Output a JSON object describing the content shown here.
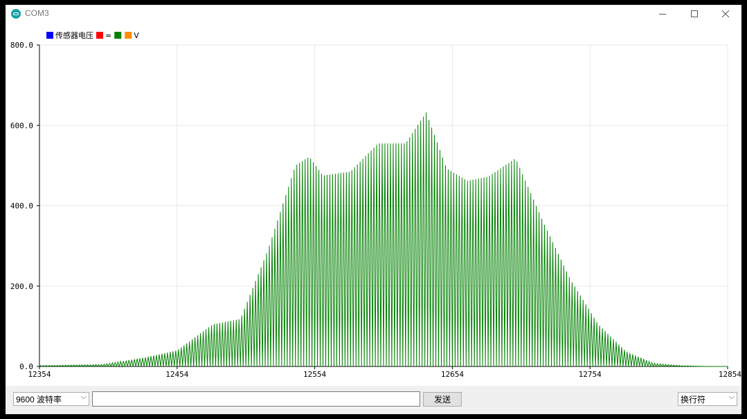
{
  "window": {
    "title": "COM3"
  },
  "legend": [
    {
      "label": "传感器电压",
      "color": "#0000ff"
    },
    {
      "label": "=",
      "color": "#ff0000"
    },
    {
      "label": "",
      "color": "#008000"
    },
    {
      "label": "V",
      "color": "#ff8c00"
    }
  ],
  "chart_data": {
    "type": "line",
    "x_ticks": [
      "12354",
      "12454",
      "12554",
      "12654",
      "12754",
      "12854"
    ],
    "y_ticks": [
      "0.0",
      "200.0",
      "400.0",
      "600.0",
      "800.0"
    ],
    "xlim": [
      12354,
      12854
    ],
    "ylim": [
      0,
      800
    ],
    "grid": true,
    "legend_placement": "top-left",
    "series": [
      {
        "name": "V",
        "color": "#008000",
        "oscillation_period": 2,
        "envelope_x": [
          12354,
          12400,
          12430,
          12454,
          12480,
          12500,
          12520,
          12540,
          12550,
          12560,
          12580,
          12600,
          12620,
          12635,
          12650,
          12665,
          12680,
          12700,
          12720,
          12740,
          12760,
          12780,
          12800,
          12820,
          12840,
          12854
        ],
        "envelope_y": [
          2,
          5,
          22,
          40,
          105,
          118,
          290,
          500,
          522,
          475,
          485,
          555,
          555,
          632,
          492,
          462,
          472,
          518,
          360,
          215,
          105,
          38,
          8,
          2,
          0,
          0
        ]
      }
    ]
  },
  "controls": {
    "baud_label": "9600 波特率",
    "send_label": "发送",
    "line_ending_label": "换行符"
  }
}
